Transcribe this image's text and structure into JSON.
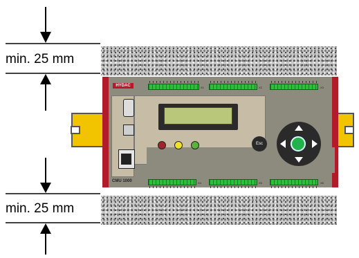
{
  "dimensions": {
    "top_label": "min. 25 mm",
    "bottom_label": "min. 25 mm"
  },
  "device": {
    "brand": "HYDAC",
    "model": "CMU 1000",
    "esc_label": "Esc",
    "terminal_labels_top": [
      "X1",
      "X2",
      "X3"
    ],
    "terminal_labels_bottom": [
      "X4",
      "X5",
      "X6"
    ],
    "led_colors": [
      "#a0262c",
      "#f2e12a",
      "#5bb33a"
    ],
    "brand_color": "#b21c2a",
    "rail_color": "#f2c400"
  }
}
